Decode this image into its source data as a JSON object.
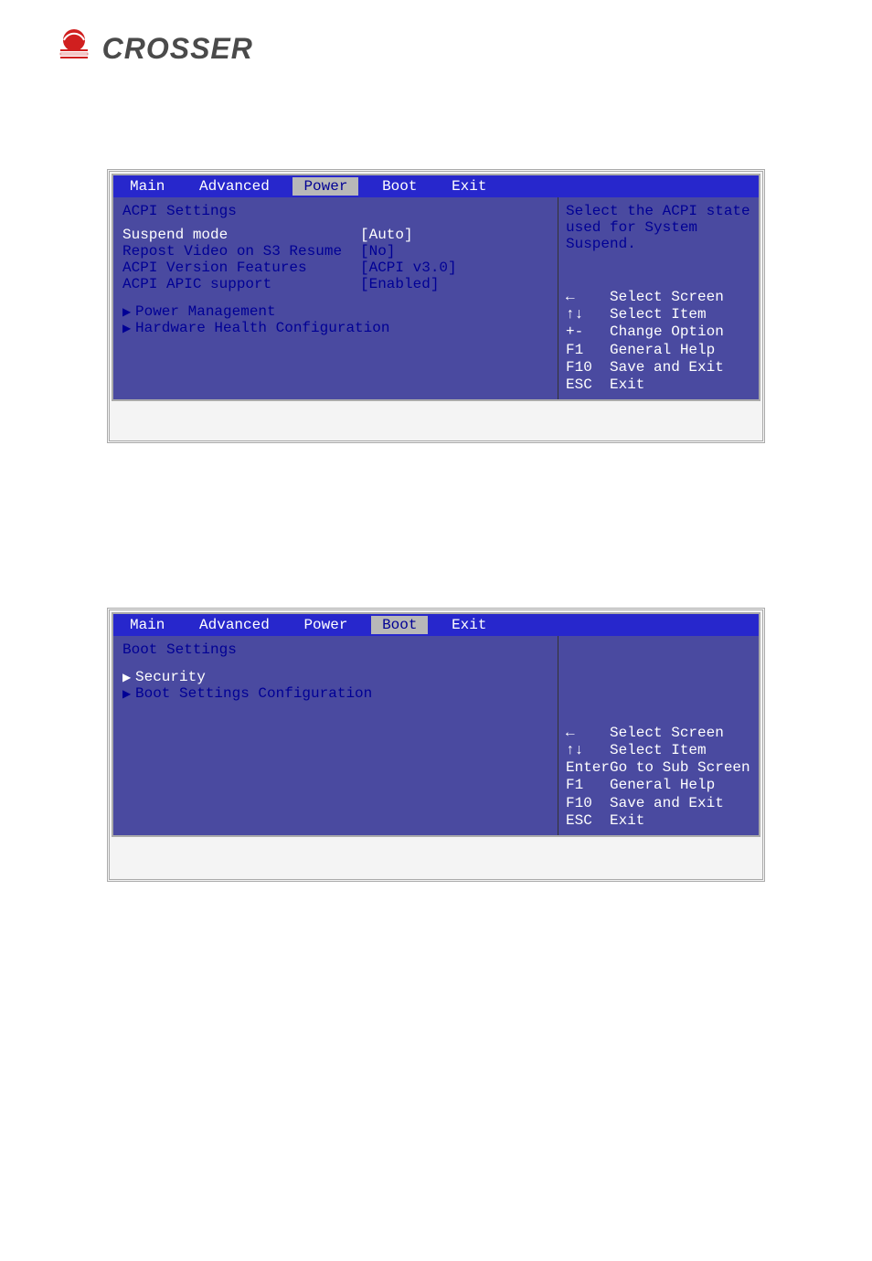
{
  "logo": {
    "text": "CROSSER"
  },
  "bios1": {
    "menubar": {
      "tabs": [
        "Main",
        "Advanced",
        "Power",
        "Boot",
        "Exit"
      ],
      "activeIndex": 2
    },
    "title": "ACPI Settings",
    "settings": [
      {
        "label": "Suspend mode",
        "value": "[Auto]",
        "selected": true
      },
      {
        "label": "Repost Video on S3 Resume",
        "value": "[No]",
        "selected": false
      },
      {
        "label": "ACPI Version Features",
        "value": "[ACPI v3.0]",
        "selected": false
      },
      {
        "label": "ACPI APIC support",
        "value": "[Enabled]",
        "selected": false
      }
    ],
    "submenus": [
      {
        "label": "Power Management",
        "selected": false
      },
      {
        "label": "Hardware Health Configuration",
        "selected": false
      }
    ],
    "help": "Select the ACPI state used for System Suspend.",
    "legend": [
      {
        "key": "←",
        "label": "Select Screen"
      },
      {
        "key": "↑↓",
        "label": "Select Item"
      },
      {
        "key": "+-",
        "label": "Change Option"
      },
      {
        "key": "F1",
        "label": "General Help"
      },
      {
        "key": "F10",
        "label": "Save and Exit"
      },
      {
        "key": "ESC",
        "label": "Exit"
      }
    ]
  },
  "bios2": {
    "menubar": {
      "tabs": [
        "Main",
        "Advanced",
        "Power",
        "Boot",
        "Exit"
      ],
      "activeIndex": 3
    },
    "title": "Boot Settings",
    "submenus": [
      {
        "label": "Security",
        "selected": true
      },
      {
        "label": "Boot Settings Configuration",
        "selected": false
      }
    ],
    "help": "",
    "legend": [
      {
        "key": "←",
        "label": "Select Screen"
      },
      {
        "key": "↑↓",
        "label": "Select Item"
      },
      {
        "key": "Enter",
        "label": "Go to Sub Screen"
      },
      {
        "key": "F1",
        "label": "General Help"
      },
      {
        "key": "F10",
        "label": "Save and Exit"
      },
      {
        "key": "ESC",
        "label": "Exit"
      }
    ]
  }
}
